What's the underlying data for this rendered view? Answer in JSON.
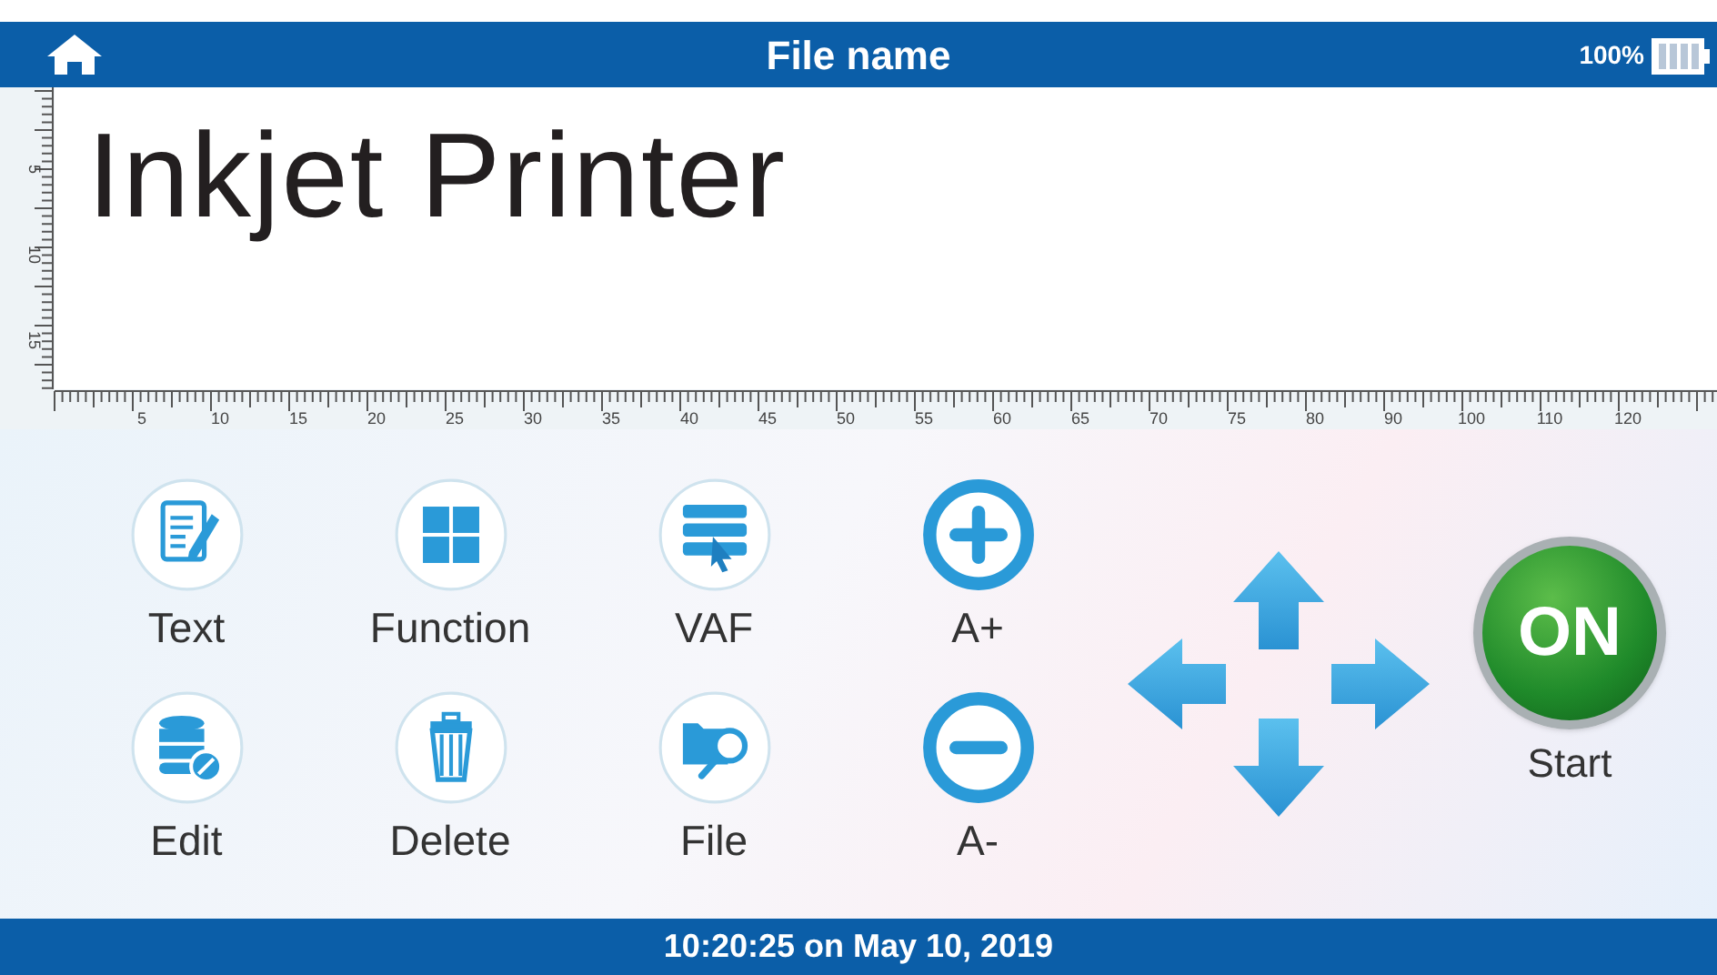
{
  "title_bar": {
    "title": "File name",
    "battery_text": "100%"
  },
  "canvas": {
    "text": "Inkjet Printer"
  },
  "rulers": {
    "horizontal_labels": [
      "5",
      "10",
      "15",
      "20",
      "25",
      "30",
      "35",
      "40",
      "45",
      "50",
      "55",
      "60",
      "65",
      "70",
      "75",
      "80",
      "90",
      "100",
      "110",
      "120"
    ],
    "vertical_labels": [
      "5",
      "10",
      "15"
    ]
  },
  "buttons": [
    {
      "kind": "text",
      "label": "Text"
    },
    {
      "kind": "function",
      "label": "Function"
    },
    {
      "kind": "vaf",
      "label": "VAF"
    },
    {
      "kind": "plus",
      "label": "A+"
    },
    {
      "kind": "edit",
      "label": "Edit"
    },
    {
      "kind": "delete",
      "label": "Delete"
    },
    {
      "kind": "file",
      "label": "File"
    },
    {
      "kind": "minus",
      "label": "A-"
    }
  ],
  "start_button": {
    "symbol": "ON",
    "label": "Start"
  },
  "status_bar": {
    "datetime": "10:20:25 on May 10, 2019"
  }
}
